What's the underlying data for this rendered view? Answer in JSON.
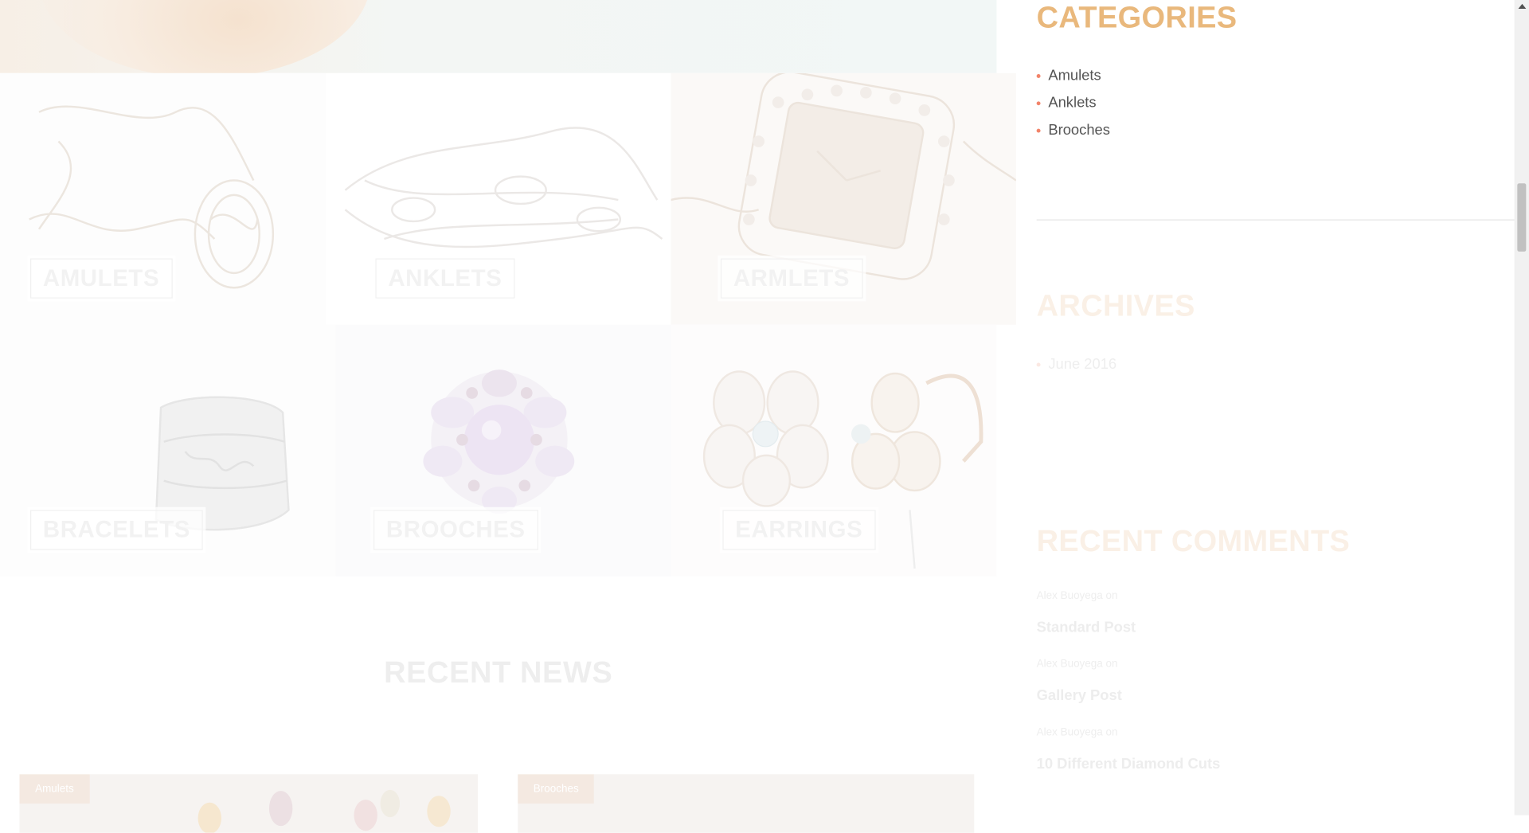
{
  "categories_grid": {
    "tiles": [
      {
        "label": "AMULETS"
      },
      {
        "label": "ANKLETS"
      },
      {
        "label": "ARMLETS"
      },
      {
        "label": "BRACELETS"
      },
      {
        "label": "BROOCHES"
      },
      {
        "label": "EARRINGS"
      }
    ]
  },
  "recent_news": {
    "title": "RECENT NEWS",
    "cards": [
      {
        "tag": "Amulets"
      },
      {
        "tag": "Brooches"
      }
    ]
  },
  "sidebar": {
    "categories": {
      "title": "CATEGORIES",
      "items": [
        "Amulets",
        "Anklets",
        "Brooches"
      ]
    },
    "archives": {
      "title": "ARCHIVES",
      "items": [
        "June 2016"
      ]
    },
    "recent_comments": {
      "title": "RECENT COMMENTS",
      "items": [
        {
          "author": "Alex Buoyega",
          "on": "on",
          "post": "Standard Post"
        },
        {
          "author": "Alex Buoyega",
          "on": "on",
          "post": "Gallery Post"
        },
        {
          "author": "Alex Buoyega",
          "on": "on",
          "post": "10 Different Diamond Cuts"
        }
      ]
    }
  },
  "colors": {
    "accent": "#e9b87c",
    "bullet": "#f2846a",
    "text": "#555555",
    "faded_text": "#eeeeee",
    "faded_heading": "#faf0e6"
  },
  "icons": {
    "scroll_up": "chevron-up-icon"
  }
}
